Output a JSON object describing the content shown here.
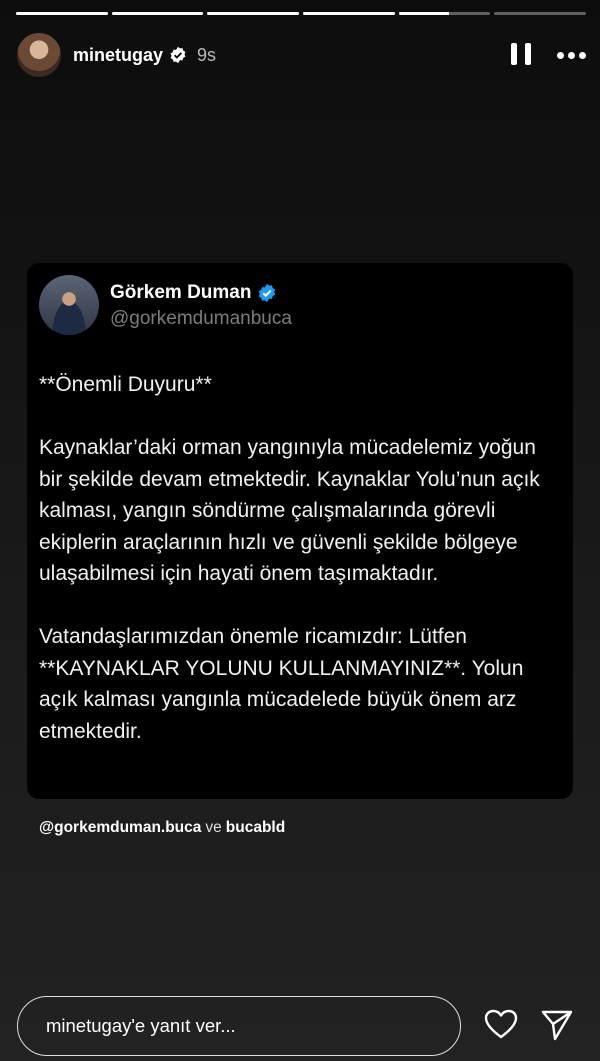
{
  "story": {
    "progress": [
      1,
      1,
      1,
      1,
      0.55,
      0
    ],
    "username": "minetugay",
    "time": "9s",
    "icons": {
      "verified": "verified-badge-icon",
      "pause": "pause-icon",
      "more": "more-options-icon"
    }
  },
  "tweet": {
    "name": "Görkem Duman",
    "handle": "@gorkemdumanbuca",
    "paragraphs": [
      "**Önemli Duyuru**",
      "Kaynaklar’daki orman yangınıyla mücadelemiz yoğun bir şekilde devam etmektedir. Kaynaklar Yolu’nun açık kalması, yangın söndürme çalışmalarında görevli ekiplerin araçlarının hızlı ve güvenli şekilde bölgeye ulaşabilmesi için hayati önem taşımaktadır.",
      "Vatandaşlarımızdan önemle ricamızdır: Lütfen **KAYNAKLAR YOLUNU KULLANMAYINIZ**. Yolun açık kalması yangınla mücadelede büyük önem arz etmektedir."
    ]
  },
  "mentions": {
    "first": "@gorkemduman.buca",
    "separator": "ve",
    "second": "bucabld"
  },
  "reply": {
    "placeholder": "minetugay'e yanıt ver...",
    "icons": {
      "like": "heart-icon",
      "share": "send-icon"
    }
  },
  "colors": {
    "verified": "#1d9bf0",
    "background": "#121212",
    "card": "#000000"
  }
}
